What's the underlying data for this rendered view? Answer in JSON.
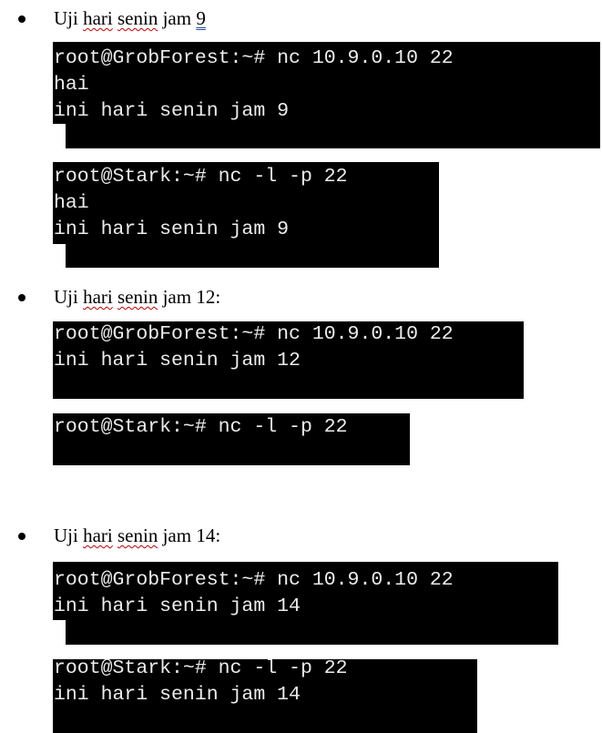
{
  "sections": [
    {
      "bullet_prefix": "Uji ",
      "bullet_word1": "hari",
      "bullet_space": " ",
      "bullet_word2": "senin",
      "bullet_mid": " jam ",
      "bullet_tail": "9",
      "client_terminal": [
        "root@GrobForest:~# nc 10.9.0.10 22",
        "hai",
        "ini hari senin jam 9"
      ],
      "server_terminal": [
        "root@Stark:~# nc -l -p 22",
        "hai",
        "ini hari senin jam 9"
      ]
    },
    {
      "bullet_prefix": "Uji ",
      "bullet_word1": "hari",
      "bullet_space": " ",
      "bullet_word2": "senin",
      "bullet_mid": " jam ",
      "bullet_tail": "12:",
      "client_terminal": [
        "root@GrobForest:~# nc 10.9.0.10 22",
        "ini hari senin jam 12"
      ],
      "server_terminal": [
        "root@Stark:~# nc -l -p 22"
      ]
    },
    {
      "bullet_prefix": "Uji ",
      "bullet_word1": "hari",
      "bullet_space": " ",
      "bullet_word2": "senin",
      "bullet_mid": " jam ",
      "bullet_tail": "14:",
      "client_terminal": [
        "root@GrobForest:~# nc 10.9.0.10 22",
        "ini hari senin jam 14"
      ],
      "server_terminal": [
        "root@Stark:~# nc -l -p 22",
        "ini hari senin jam 14"
      ]
    }
  ]
}
